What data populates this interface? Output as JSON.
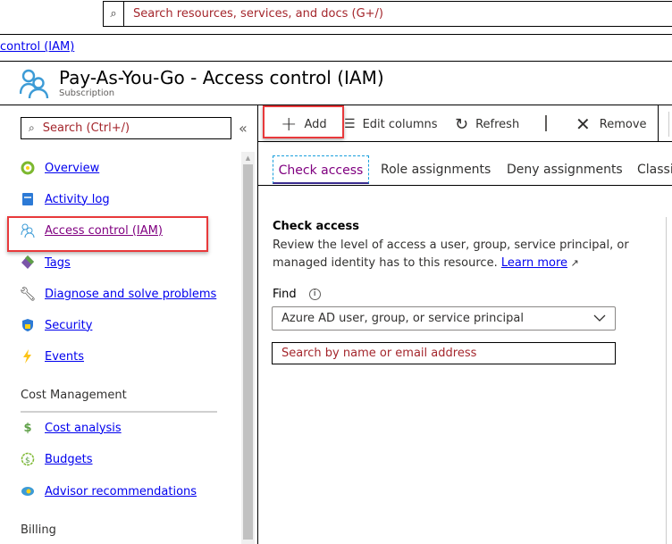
{
  "topbar": {
    "search_placeholder": "Search resources, services, and docs (G+/)"
  },
  "breadcrumb": {
    "current": "control (IAM)"
  },
  "header": {
    "title": "Pay-As-You-Go - Access control (IAM)",
    "subtitle": "Subscription"
  },
  "sidebar": {
    "search_placeholder": "Search (Ctrl+/)",
    "collapse": "«",
    "items": [
      {
        "label": "Overview"
      },
      {
        "label": "Activity log"
      },
      {
        "label": "Access control (IAM)"
      },
      {
        "label": "Tags"
      },
      {
        "label": "Diagnose and solve problems"
      },
      {
        "label": "Security"
      },
      {
        "label": "Events"
      }
    ],
    "sections": [
      {
        "title": "Cost Management",
        "items": [
          {
            "label": "Cost analysis"
          },
          {
            "label": "Budgets"
          },
          {
            "label": "Advisor recommendations"
          }
        ]
      },
      {
        "title": "Billing"
      }
    ]
  },
  "toolbar": {
    "add": "Add",
    "edit_columns": "Edit columns",
    "refresh": "Refresh",
    "remove": "Remove"
  },
  "tabs": [
    {
      "label": "Check access"
    },
    {
      "label": "Role assignments"
    },
    {
      "label": "Deny assignments"
    },
    {
      "label": "Classi"
    }
  ],
  "check_access": {
    "title": "Check access",
    "desc_line1": "Review the level of access a user, group, service principal, or",
    "desc_line2": "managed identity has to this resource.",
    "learn_more": "Learn more",
    "find_label": "Find",
    "find_select": "Azure AD user, group, or service principal",
    "search_placeholder": "Search by name or email address"
  },
  "colors": {
    "highlight": "#e8393b",
    "link": "#0000ee",
    "visited": "#800080",
    "placeholder": "#a4262c"
  }
}
